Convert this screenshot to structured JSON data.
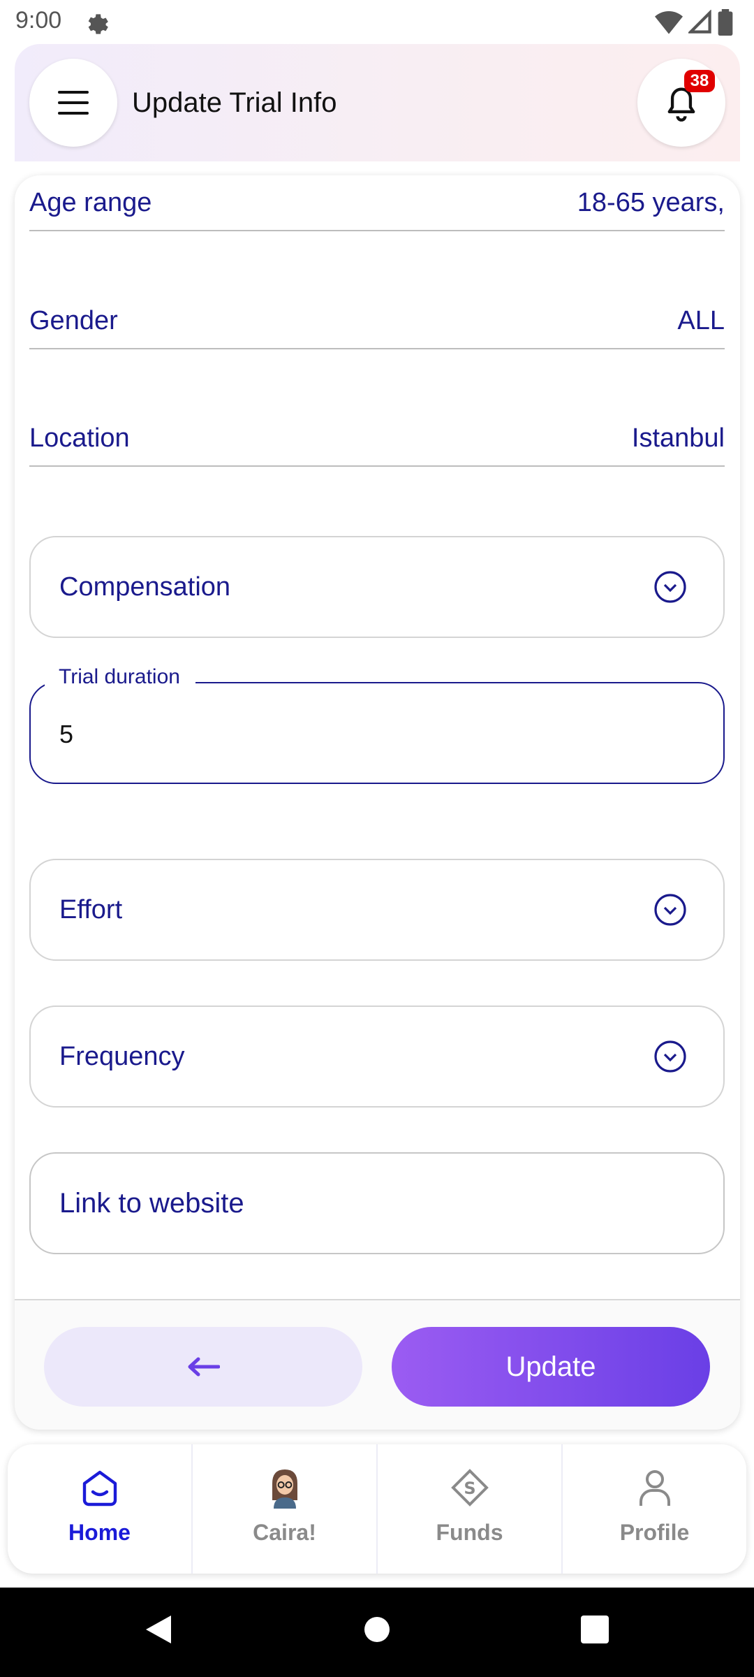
{
  "status": {
    "time": "9:00"
  },
  "header": {
    "title": "Update Trial Info",
    "notifications": "38"
  },
  "form": {
    "age_label": "Age range",
    "age_value": "18-65 years,",
    "gender_label": "Gender",
    "gender_value": "ALL",
    "location_label": "Location",
    "location_value": "Istanbul",
    "compensation_label": "Compensation",
    "trial_duration_label": "Trial duration",
    "trial_duration_value": "5",
    "effort_label": "Effort",
    "frequency_label": "Frequency",
    "link_placeholder": "Link to website"
  },
  "footer": {
    "update_label": "Update"
  },
  "tabs": [
    {
      "label": "Home",
      "icon": "home-icon"
    },
    {
      "label": "Caira!",
      "icon": "avatar-icon"
    },
    {
      "label": "Funds",
      "icon": "funds-icon"
    },
    {
      "label": "Profile",
      "icon": "profile-icon"
    }
  ],
  "colors": {
    "accent": "#1a1a8c",
    "primary": "#7b4bec",
    "badge": "#e00000",
    "active_tab": "#1b1bd8"
  }
}
